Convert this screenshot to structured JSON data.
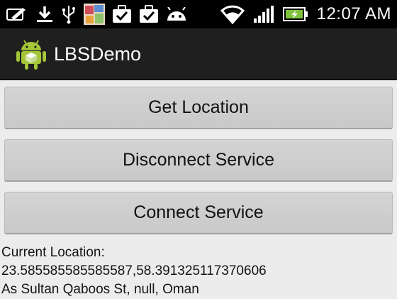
{
  "status_bar": {
    "time": "12:07 AM",
    "left_icons": [
      "edit-icon",
      "download-icon",
      "usb-icon",
      "photo-notification-icon",
      "task-done-icon",
      "task-done-icon",
      "android-icon"
    ],
    "right_icons": [
      "wifi-icon",
      "signal-icon",
      "battery-charging-icon"
    ]
  },
  "action_bar": {
    "title": "LBSDemo",
    "icon": "android-app-icon"
  },
  "buttons": {
    "get_location": "Get Location",
    "disconnect": "Disconnect Service",
    "connect": "Connect Service"
  },
  "result": {
    "label": "Current Location:",
    "coordinates": "23.585585585585587,58.391325117370606",
    "address": "As Sultan Qaboos St, null, Oman"
  },
  "colors": {
    "status_bar": "#000000",
    "action_bar": "#1f1f1f",
    "background": "#ececec",
    "button": "#d0d0d0",
    "battery": "#7ec13a"
  }
}
